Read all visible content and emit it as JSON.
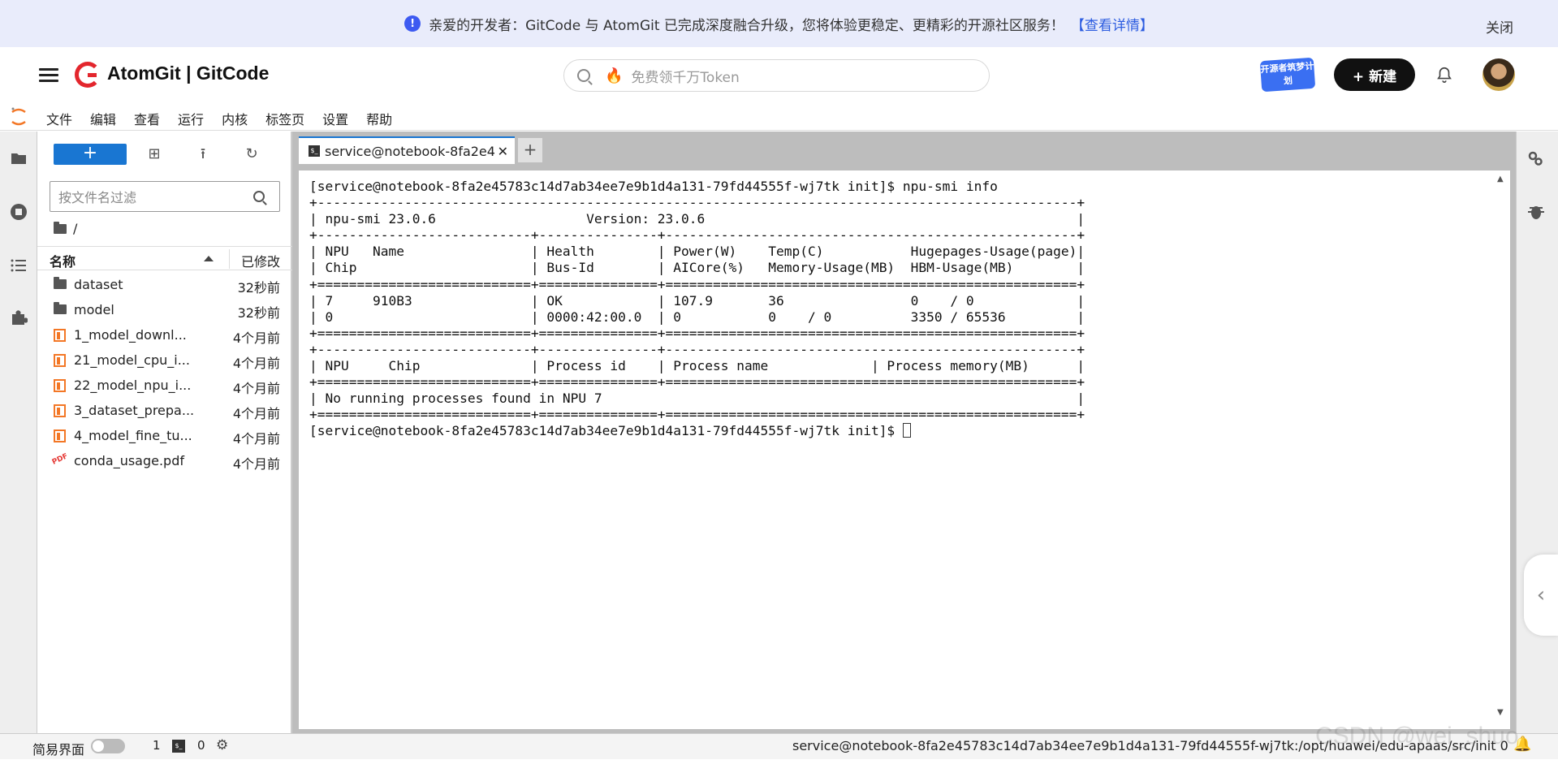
{
  "banner": {
    "message": "亲爱的开发者：GitCode 与 AtomGit 已完成深度融合升级，您将体验更稳定、更精彩的开源社区服务！",
    "link": "【查看详情】",
    "close": "关闭"
  },
  "header": {
    "brand": "AtomGit | GitCode",
    "search_placeholder": "免费领千万Token",
    "promo": "开源者筑梦计划",
    "new_button": "+ 新建"
  },
  "menu": [
    "文件",
    "编辑",
    "查看",
    "运行",
    "内核",
    "标签页",
    "设置",
    "帮助"
  ],
  "filebrowser": {
    "new_label": "+",
    "filter_placeholder": "按文件名过滤",
    "crumb": "/",
    "col_name": "名称",
    "col_modified": "已修改",
    "files": [
      {
        "name": "dataset",
        "type": "folder",
        "modified": "32秒前"
      },
      {
        "name": "model",
        "type": "folder",
        "modified": "32秒前"
      },
      {
        "name": "1_model_downl...",
        "type": "notebook",
        "modified": "4个月前"
      },
      {
        "name": "21_model_cpu_i...",
        "type": "notebook",
        "modified": "4个月前"
      },
      {
        "name": "22_model_npu_i...",
        "type": "notebook",
        "modified": "4个月前"
      },
      {
        "name": "3_dataset_prepa...",
        "type": "notebook",
        "modified": "4个月前"
      },
      {
        "name": "4_model_fine_tu...",
        "type": "notebook",
        "modified": "4个月前"
      },
      {
        "name": "conda_usage.pdf",
        "type": "pdf",
        "modified": "4个月前"
      }
    ]
  },
  "terminal": {
    "tab_title": "service@notebook-8fa2e4",
    "add_tab": "+",
    "output": "[service@notebook-8fa2e45783c14d7ab34ee7e9b1d4a131-79fd44555f-wj7tk init]$ npu-smi info\n+------------------------------------------------------------------------------------------------+\n| npu-smi 23.0.6                   Version: 23.0.6                                               |\n+---------------------------+---------------+----------------------------------------------------+\n| NPU   Name                | Health        | Power(W)    Temp(C)           Hugepages-Usage(page)|\n| Chip                      | Bus-Id        | AICore(%)   Memory-Usage(MB)  HBM-Usage(MB)        |\n+===========================+===============+====================================================+\n| 7     910B3               | OK            | 107.9       36                0    / 0             |\n| 0                         | 0000:42:00.0  | 0           0    / 0          3350 / 65536         |\n+===========================+===============+====================================================+\n+---------------------------+---------------+----------------------------------------------------+\n| NPU     Chip              | Process id    | Process name             | Process memory(MB)      |\n+===========================+===============+====================================================+\n| No running processes found in NPU 7                                                            |\n+===========================+===============+====================================================+\n",
    "prompt": "[service@notebook-8fa2e45783c14d7ab34ee7e9b1d4a131-79fd44555f-wj7tk init]$ "
  },
  "status": {
    "simple_mode": "简易界面",
    "count1": "1",
    "count2": "0",
    "path": "service@notebook-8fa2e45783c14d7ab34ee7e9b1d4a131-79fd44555f-wj7tk:/opt/huawei/edu-apaas/src/init",
    "trailing": "0"
  },
  "watermark": "CSDN @wei_shuo"
}
